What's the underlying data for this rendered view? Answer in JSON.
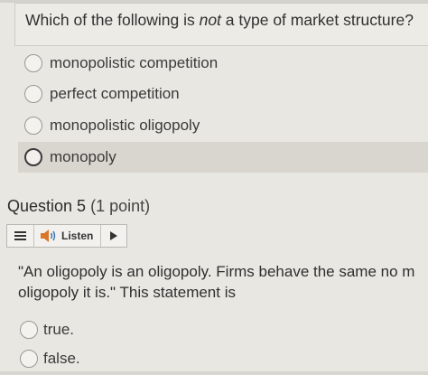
{
  "question4": {
    "text_before": "Which of the following is ",
    "text_emphasis": "not",
    "text_after": " a type of market structure?",
    "options": [
      {
        "label": "monopolistic competition"
      },
      {
        "label": "perfect competition"
      },
      {
        "label": "monopolistic oligopoly"
      },
      {
        "label": "monopoly"
      }
    ]
  },
  "question5": {
    "title": "Question 5",
    "points": "(1 point)",
    "toolbar": {
      "menu_icon": "hamburger-menu-icon",
      "listen_icon": "speaker-icon",
      "listen_label": "Listen",
      "play_icon": "play-icon"
    },
    "statement_line1": "\"An oligopoly is an oligopoly. Firms behave the same no m",
    "statement_line2": "oligopoly it is.\" This statement is",
    "options": [
      {
        "label": "true."
      },
      {
        "label": "false."
      }
    ]
  },
  "colors": {
    "background": "#e9e7e2",
    "highlight_row": "#d9d6d0",
    "text": "#2f2f2f"
  }
}
